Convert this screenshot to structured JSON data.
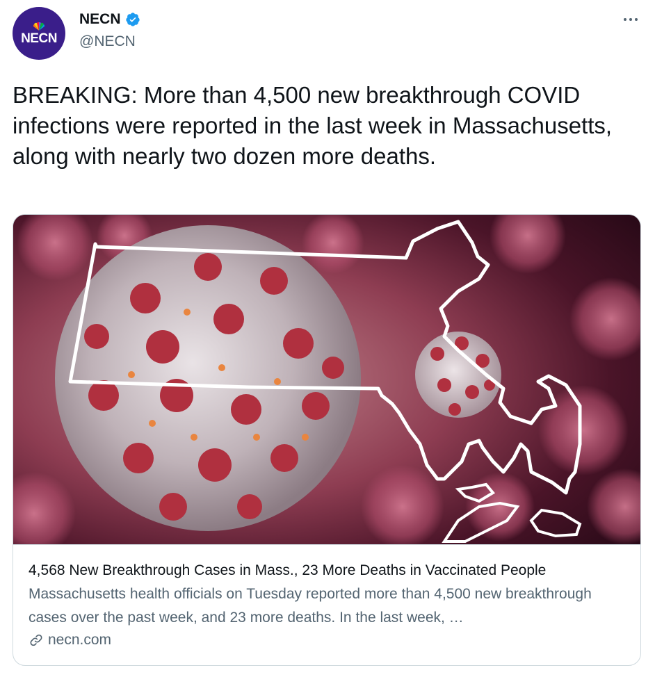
{
  "account": {
    "display_name": "NECN",
    "handle": "@NECN",
    "avatar_text": "NECN",
    "verified": true,
    "avatar_color": "#3a1e8a",
    "verified_color": "#1d9bf0"
  },
  "tweet": {
    "text": "BREAKING: More than 4,500 new breakthrough COVID infections were reported in the last week in Massachusetts, along with nearly two dozen more deaths."
  },
  "card": {
    "image_description_icon": "covid-virus-massachusetts-map-image",
    "title": "4,568 New Breakthrough Cases in Mass., 23 More Deaths in Vaccinated People",
    "description": "Massachusetts health officials on Tuesday reported more than 4,500 new breakthrough cases over the past week, and 23 more deaths. In the last week, …",
    "domain": "necn.com"
  },
  "icons": {
    "more": "more-options-icon",
    "link": "link-icon",
    "verified": "verified-badge-icon"
  }
}
